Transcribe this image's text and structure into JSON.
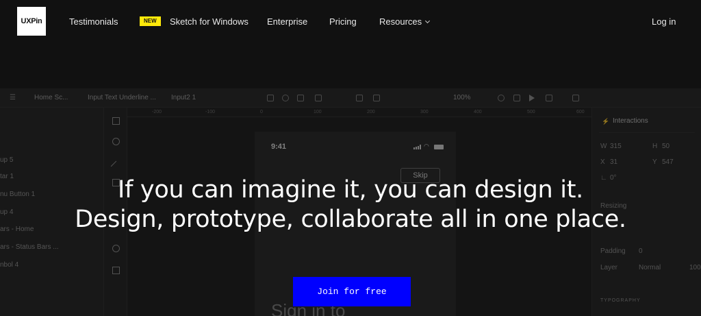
{
  "nav": {
    "logo": "UXPin",
    "items": [
      {
        "label": "Testimonials"
      },
      {
        "label": "Sketch for Windows",
        "badge": "NEW"
      },
      {
        "label": "Enterprise"
      },
      {
        "label": "Pricing"
      },
      {
        "label": "Resources",
        "has_dropdown": true
      }
    ],
    "login": "Log in"
  },
  "editor": {
    "breadcrumbs": [
      "Home Sc...",
      "Input Text Underline ...",
      "Input2 1"
    ],
    "zoom": "100%",
    "layers": [
      "up 5",
      "tar 1",
      "nu Button 1",
      "up 4",
      "ars - Home",
      "ars - Status Bars ...",
      "nbol 4"
    ],
    "ruler_ticks": [
      "-200",
      "-100",
      "0",
      "100",
      "200",
      "300",
      "400",
      "500",
      "600"
    ],
    "phone": {
      "time": "9:41",
      "skip": "Skip",
      "heading": "Sign in to"
    },
    "right_panel": {
      "title": "Interactions",
      "fields": [
        {
          "label": "W",
          "value": "315"
        },
        {
          "label": "H",
          "value": "50"
        },
        {
          "label": "X",
          "value": "31"
        },
        {
          "label": "Y",
          "value": "547"
        },
        {
          "label": "∟",
          "value": "0°"
        }
      ],
      "resizing": "Resizing",
      "padding": {
        "label": "Padding",
        "value": "0"
      },
      "layer": {
        "label": "Layer",
        "value": "Normal",
        "opacity": "100"
      },
      "typography": "TYPOGRAPHY"
    }
  },
  "hero": {
    "line1": "If you can imagine it, you can design it.",
    "line2": "Design, prototype, collaborate all in one place.",
    "cta": "Join for free"
  },
  "colors": {
    "cta": "#0000ff",
    "badge": "#ffe90a",
    "background": "#111111"
  }
}
